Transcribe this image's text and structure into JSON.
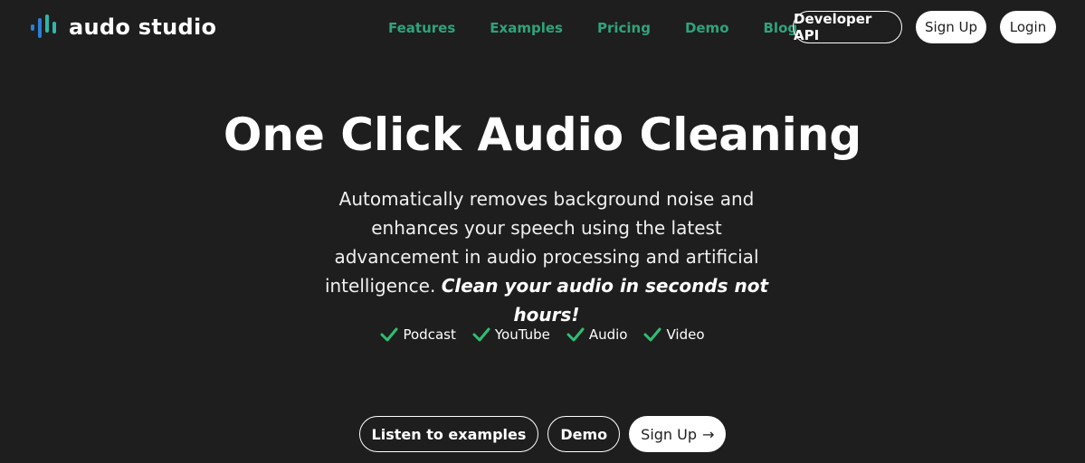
{
  "brand": {
    "name": "audo studio",
    "logo_icon": "audio-waveform-logo-icon",
    "accent_colors": [
      "#2b7fd6",
      "#2fb7a8"
    ]
  },
  "nav": {
    "links": [
      "Features",
      "Examples",
      "Pricing",
      "Demo",
      "Blog"
    ],
    "link_color": "#2fa37a"
  },
  "header_actions": {
    "developer_api": "Developer API",
    "sign_up": "Sign Up",
    "login": "Login"
  },
  "hero": {
    "title": "One Click Audio Cleaning",
    "subtitle": "Automatically removes background noise and enhances your speech using the latest advancement in audio processing and artificial intelligence.",
    "subtitle_emphasis": "Clean your audio in seconds not hours!"
  },
  "use_cases": {
    "icon": "checkmark-icon",
    "check_color": "#2fbf71",
    "items": [
      "Podcast",
      "YouTube",
      "Audio",
      "Video"
    ]
  },
  "cta": {
    "listen_examples": "Listen to examples",
    "demo": "Demo",
    "sign_up": "Sign Up",
    "sign_up_icon": "arrow-right-icon"
  },
  "colors": {
    "background": "#1e1e1e",
    "text": "#ffffff"
  }
}
